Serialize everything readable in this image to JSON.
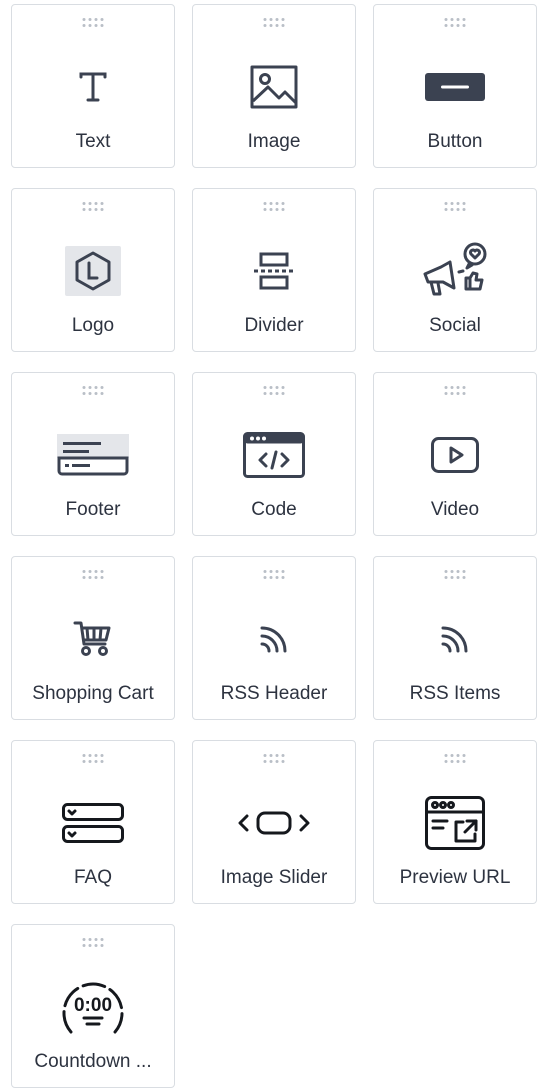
{
  "tiles": [
    {
      "label": "Text",
      "icon": "text-icon"
    },
    {
      "label": "Image",
      "icon": "image-icon"
    },
    {
      "label": "Button",
      "icon": "button-icon"
    },
    {
      "label": "Logo",
      "icon": "logo-icon"
    },
    {
      "label": "Divider",
      "icon": "divider-icon"
    },
    {
      "label": "Social",
      "icon": "social-icon"
    },
    {
      "label": "Footer",
      "icon": "footer-icon"
    },
    {
      "label": "Code",
      "icon": "code-icon"
    },
    {
      "label": "Video",
      "icon": "video-icon"
    },
    {
      "label": "Shopping Cart",
      "icon": "shopping-cart-icon"
    },
    {
      "label": "RSS Header",
      "icon": "rss-icon"
    },
    {
      "label": "RSS Items",
      "icon": "rss-icon"
    },
    {
      "label": "FAQ",
      "icon": "faq-icon"
    },
    {
      "label": "Image Slider",
      "icon": "image-slider-icon"
    },
    {
      "label": "Preview URL",
      "icon": "preview-url-icon"
    },
    {
      "label": "Countdown ...",
      "icon": "countdown-icon"
    }
  ],
  "colors": {
    "icon": "#3b4251",
    "border": "#d9dde2",
    "label": "#2d3340",
    "grip": "#b9bfc7"
  }
}
